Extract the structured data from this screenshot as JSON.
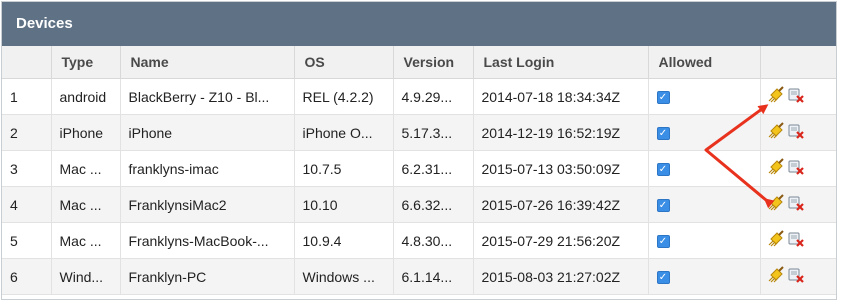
{
  "panel": {
    "title": "Devices"
  },
  "columns": {
    "index": "",
    "type": "Type",
    "name": "Name",
    "os": "OS",
    "version": "Version",
    "last_login": "Last Login",
    "allowed": "Allowed",
    "actions": ""
  },
  "rows": [
    {
      "index": "1",
      "type": "android",
      "name": "BlackBerry - Z10 - Bl...",
      "os": "REL (4.2.2)",
      "version": "4.9.29...",
      "last_login": "2014-07-18 18:34:34Z",
      "allowed": true
    },
    {
      "index": "2",
      "type": "iPhone",
      "name": "iPhone",
      "os": "iPhone O...",
      "version": "5.17.3...",
      "last_login": "2014-12-19 16:52:19Z",
      "allowed": true
    },
    {
      "index": "3",
      "type": "Mac ...",
      "name": "franklyns-imac",
      "os": "10.7.5",
      "version": "6.2.31...",
      "last_login": "2015-07-13 03:50:09Z",
      "allowed": true
    },
    {
      "index": "4",
      "type": "Mac ...",
      "name": "FranklynsiMac2",
      "os": "10.10",
      "version": "6.6.32...",
      "last_login": "2015-07-26 16:39:42Z",
      "allowed": true
    },
    {
      "index": "5",
      "type": "Mac ...",
      "name": "Franklyns-MacBook-...",
      "os": "10.9.4",
      "version": "4.8.30...",
      "last_login": "2015-07-29 21:56:20Z",
      "allowed": true
    },
    {
      "index": "6",
      "type": "Wind...",
      "name": "Franklyn-PC",
      "os": "Windows ...",
      "version": "6.1.14...",
      "last_login": "2015-08-03 21:27:02Z",
      "allowed": true
    }
  ],
  "icons": {
    "checkbox": "checkbox-checked-icon",
    "clean": "broom-icon",
    "remove": "remove-device-icon"
  },
  "colors": {
    "header_bg": "#5f7285",
    "checkbox": "#3a8ee6",
    "annotation_arrow": "#e8321e"
  }
}
